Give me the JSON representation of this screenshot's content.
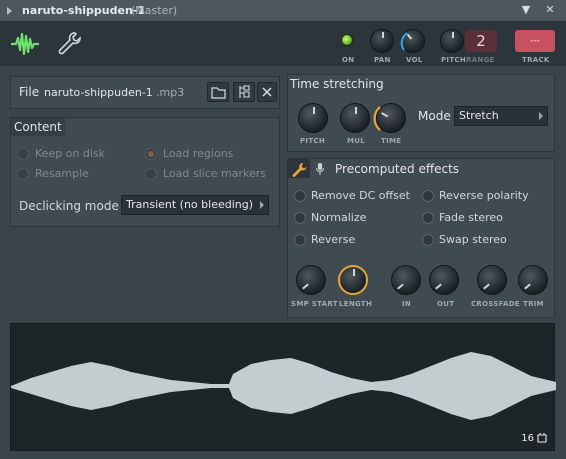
{
  "window": {
    "title": "naruto-shippuden-1",
    "subtitle": "(Master)",
    "menu_glyph": "▼",
    "close_glyph": "✕"
  },
  "toolbar": {
    "on_label": "ON",
    "pan_label": "PAN",
    "vol_label": "VOL",
    "pitch_label": "PITCH",
    "range_label": "RANGE",
    "range_value": "2",
    "track_label": "TRACK",
    "track_value": "---",
    "colors": {
      "led_on": "#7cdc38",
      "accent": "#c8505f",
      "vol_arc": "#3aa6e6"
    }
  },
  "file": {
    "label": "File",
    "name": "naruto-shippuden-1",
    "ext": ".mp3",
    "icons": [
      "folder-icon",
      "open-in-icon",
      "close-icon"
    ]
  },
  "content": {
    "title": "Content",
    "options": [
      {
        "label": "Keep on disk",
        "checked": false,
        "enabled": false
      },
      {
        "label": "Load regions",
        "checked": true,
        "enabled": false
      },
      {
        "label": "Resample",
        "checked": false,
        "enabled": false
      },
      {
        "label": "Load slice markers",
        "checked": false,
        "enabled": false
      }
    ],
    "declicking_label": "Declicking mode",
    "declicking_value": "Transient (no bleeding)"
  },
  "time_stretching": {
    "title": "Time stretching",
    "knobs": [
      "PITCH",
      "MUL",
      "TIME"
    ],
    "mode_label": "Mode",
    "mode_value": "Stretch",
    "colors": {
      "time_arc": "#e6a43a"
    }
  },
  "effects": {
    "title": "Precomputed effects",
    "left": [
      "Remove DC offset",
      "Normalize",
      "Reverse"
    ],
    "right": [
      "Reverse polarity",
      "Fade stereo",
      "Swap stereo"
    ],
    "knobs": [
      "SMP START",
      "LENGTH",
      "IN",
      "OUT",
      "CROSSFADE",
      "TRIM"
    ],
    "colors": {
      "length_ring": "#e6a43a",
      "wrench": "#e6a43a"
    }
  },
  "waveform": {
    "zoom_value": "16",
    "colors": {
      "wave": "#c5ccd0",
      "bg": "#1e2529"
    }
  }
}
